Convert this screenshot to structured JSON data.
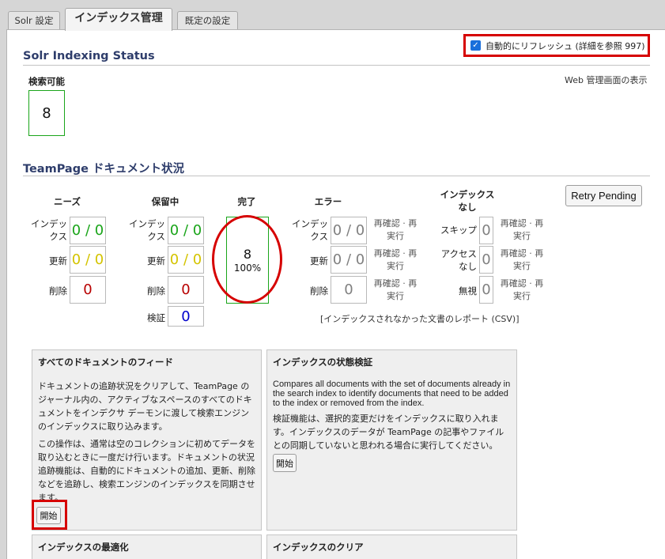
{
  "tabs": [
    {
      "label": "Solr 設定"
    },
    {
      "label": "インデックス管理"
    },
    {
      "label": "既定の設定"
    }
  ],
  "auto_refresh": {
    "label": "自動的にリフレッシュ (詳細を参照 997)",
    "checked": true
  },
  "web_admin_link": "Web 管理画面の表示",
  "solr_status": {
    "title": "Solr Indexing Status",
    "searchable_label": "検索可能",
    "searchable_value": "8"
  },
  "teampage_status": {
    "title": "TeamPage ドキュメント状況",
    "retry_button": "Retry Pending",
    "needs": {
      "header": "ニーズ",
      "rows": [
        {
          "label": "インデッ\nクス",
          "value": "0 / 0"
        },
        {
          "label": "更新",
          "value": "0 / 0"
        },
        {
          "label": "削除",
          "value": "0"
        }
      ]
    },
    "pending": {
      "header": "保留中",
      "rows": [
        {
          "label": "インデッ\nクス",
          "value": "0 / 0"
        },
        {
          "label": "更新",
          "value": "0 / 0"
        },
        {
          "label": "削除",
          "value": "0"
        },
        {
          "label": "検証",
          "value": "0"
        }
      ]
    },
    "done": {
      "header": "完了",
      "value": "8",
      "percent": "100%"
    },
    "errors": {
      "header": "エラー",
      "rows": [
        {
          "label": "インデッ\nクス",
          "value": "0 / 0",
          "action": "再確認 · 再\n実行"
        },
        {
          "label": "更新",
          "value": "0 / 0",
          "action": "再確認 · 再\n実行"
        },
        {
          "label": "削除",
          "value": "0",
          "action": "再確認 · 再\n実行"
        }
      ]
    },
    "not_indexed": {
      "header": "インデックス\nなし",
      "rows": [
        {
          "label": "スキップ",
          "value": "0",
          "action": "再確認 · 再\n実行"
        },
        {
          "label": "アクセス\nなし",
          "value": "0",
          "action": "再確認 · 再\n実行"
        },
        {
          "label": "無視",
          "value": "0",
          "action": "再確認 · 再\n実行"
        }
      ]
    },
    "csv_report": "[インデックスされなかった文書のレポート (CSV)]"
  },
  "cards": {
    "feed_all": {
      "title": "すべてのドキュメントのフィード",
      "p1": "ドキュメントの追跡状況をクリアして、TeamPage のジャーナル内の、アクティブなスペースのすべてのドキュメントをインデクサ デーモンに渡して検索エンジンのインデックスに取り込みます。",
      "p2": "この操作は、通常は空のコレクションに初めてデータを取り込むときに一度だけ行います。ドキュメントの状況追跡機能は、自動的にドキュメントの追加、更新、削除などを追跡し、検索エンジンのインデックスを同期させます。",
      "button": "開始"
    },
    "verify": {
      "title": "インデックスの状態検証",
      "p1": "Compares all documents with the set of documents already in the search index to identify documents that need to be added to the index or removed from the index.",
      "p2": "検証機能は、選択的変更だけをインデックスに取り入れます。インデックスのデータが TeamPage の記事やファイルとの同期していないと思われる場合に実行してください。",
      "button": "開始"
    },
    "optimize": {
      "title": "インデックスの最適化"
    },
    "clear": {
      "title": "インデックスのクリア"
    }
  },
  "colors": {
    "green": "#1aa51a",
    "yellow": "#d4c400",
    "red": "#b80000",
    "blue": "#0000cc",
    "gray": "#808080",
    "highlight": "#d60000",
    "heading": "#2e3d6b"
  }
}
